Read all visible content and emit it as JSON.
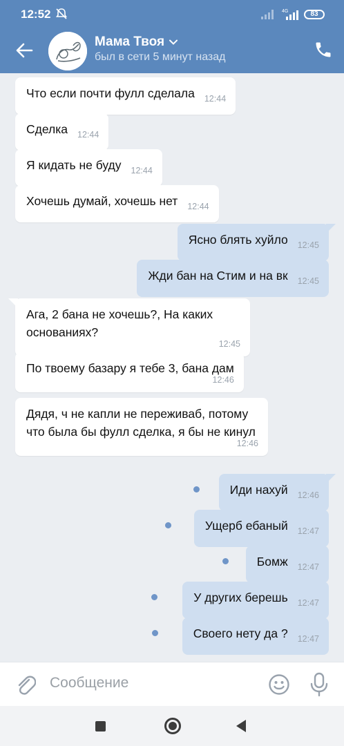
{
  "status_bar": {
    "time": "12:52",
    "network": "4G",
    "battery": "83"
  },
  "header": {
    "name": "Мама Твоя",
    "status": "был в сети 5 минут назад"
  },
  "messages": [
    {
      "dir": "in",
      "text": "Что если почти фулл сделала",
      "time": "12:44"
    },
    {
      "dir": "in",
      "text": "Сделка",
      "time": "12:44"
    },
    {
      "dir": "in",
      "text": "Я кидать не буду",
      "time": "12:44"
    },
    {
      "dir": "in",
      "text": "Хочешь думай, хочешь нет",
      "time": "12:44"
    },
    {
      "dir": "out",
      "text": "Ясно блять хуйло",
      "time": "12:45"
    },
    {
      "dir": "out",
      "text": "Жди бан на Стим и на вк",
      "time": "12:45"
    },
    {
      "dir": "in",
      "text": "Ага, 2 бана не хочешь?, На каких основаниях?",
      "time": "12:45"
    },
    {
      "dir": "in",
      "text": "По твоему базару я тебе 3, бана дам",
      "time": "12:46"
    },
    {
      "dir": "in",
      "text": "Дядя, ч не капли не переживаб, потому что была бы фулл сделка, я бы не кинул",
      "time": "12:46"
    },
    {
      "dir": "out",
      "text": "Иди нахуй",
      "time": "12:46"
    },
    {
      "dir": "out",
      "text": "Ущерб ебаный",
      "time": "12:47"
    },
    {
      "dir": "out",
      "text": "Бомж",
      "time": "12:47"
    },
    {
      "dir": "out",
      "text": "У других берешь",
      "time": "12:47"
    },
    {
      "dir": "out",
      "text": "Своего нету да ?",
      "time": "12:47"
    }
  ],
  "composer": {
    "placeholder": "Сообщение"
  },
  "icons": {
    "back": "arrow-left-icon",
    "phone": "phone-icon",
    "attach": "paperclip-icon",
    "emoji": "smile-icon",
    "mic": "microphone-icon"
  },
  "colors": {
    "header": "#5b88bd",
    "incoming": "#ffffff",
    "outgoing": "#cfdef0",
    "unread_dot": "#6f95c8",
    "background": "#ebeef2"
  }
}
